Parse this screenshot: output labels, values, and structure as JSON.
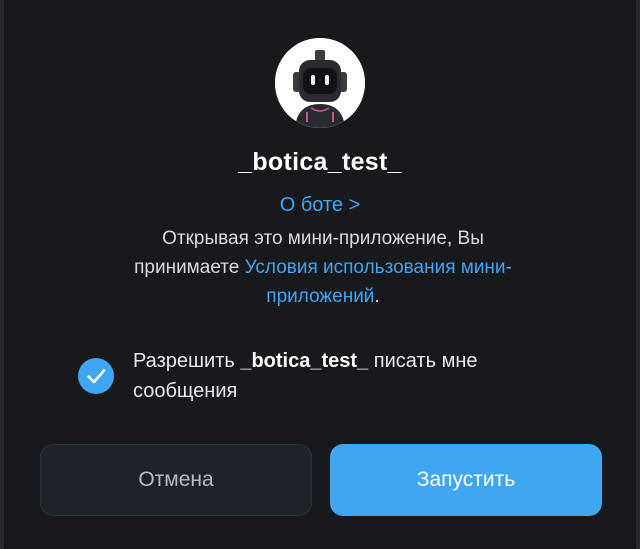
{
  "bot": {
    "name": "_botica_test_",
    "avatar_icon": "robot-avatar-icon"
  },
  "about_link": "О боте >",
  "terms": {
    "prefix_line1": "Открывая это мини-приложение, Вы",
    "prefix_line2": "принимаете ",
    "link": "Условия использования мини-приложений",
    "suffix": "."
  },
  "permission": {
    "checked": true,
    "text_before": "Разрешить ",
    "bot_name": "_botica_test_",
    "text_after": " писать мне сообщения",
    "check_icon": "check-icon"
  },
  "buttons": {
    "cancel_label": "Отмена",
    "launch_label": "Запустить"
  },
  "colors": {
    "accent": "#3ea6f2",
    "dialog_bg": "#18191c",
    "cancel_bg": "#1e2229"
  }
}
